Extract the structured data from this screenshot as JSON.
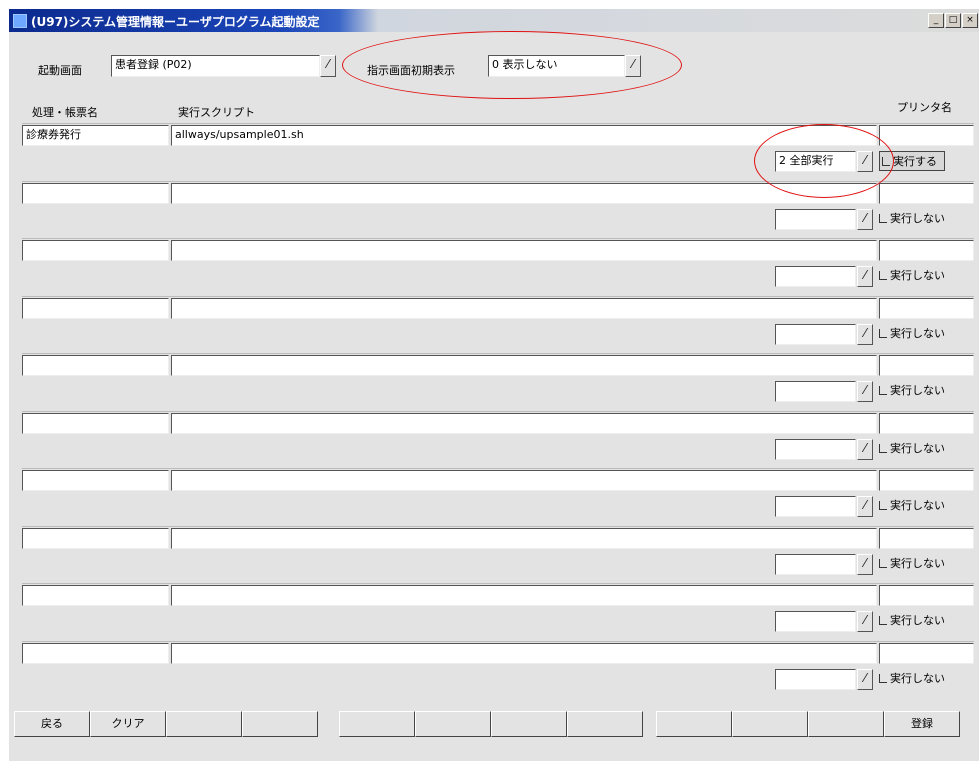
{
  "window": {
    "title": "(U97)システム管理情報ーユーザプログラム起動設定",
    "controls": [
      "_",
      "□",
      "×"
    ]
  },
  "top": {
    "startup_label": "起動画面",
    "startup_value": "患者登録 (P02)",
    "initial_display_label": "指示画面初期表示",
    "initial_display_value": "0 表示しない"
  },
  "columns": {
    "name": "処理・帳票名",
    "script": "実行スクリプト",
    "printer": "プリンタ名"
  },
  "rows": [
    {
      "name": "診療券発行",
      "script": "allways/upsample01.sh",
      "printer": "",
      "mode": "2 全部実行",
      "exec": "実行する",
      "checked": true
    },
    {
      "name": "",
      "script": "",
      "printer": "",
      "mode": "",
      "exec": "実行しない",
      "checked": false
    },
    {
      "name": "",
      "script": "",
      "printer": "",
      "mode": "",
      "exec": "実行しない",
      "checked": false
    },
    {
      "name": "",
      "script": "",
      "printer": "",
      "mode": "",
      "exec": "実行しない",
      "checked": false
    },
    {
      "name": "",
      "script": "",
      "printer": "",
      "mode": "",
      "exec": "実行しない",
      "checked": false
    },
    {
      "name": "",
      "script": "",
      "printer": "",
      "mode": "",
      "exec": "実行しない",
      "checked": false
    },
    {
      "name": "",
      "script": "",
      "printer": "",
      "mode": "",
      "exec": "実行しない",
      "checked": false
    },
    {
      "name": "",
      "script": "",
      "printer": "",
      "mode": "",
      "exec": "実行しない",
      "checked": false
    },
    {
      "name": "",
      "script": "",
      "printer": "",
      "mode": "",
      "exec": "実行しない",
      "checked": false
    },
    {
      "name": "",
      "script": "",
      "printer": "",
      "mode": "",
      "exec": "実行しない",
      "checked": false
    }
  ],
  "fkeys": [
    "戻る",
    "クリア",
    "",
    "",
    "",
    "",
    "",
    "",
    "",
    "",
    "",
    "登録"
  ],
  "colors": {
    "annotation": "#e01010",
    "titlebar": "#0c2a8e"
  }
}
